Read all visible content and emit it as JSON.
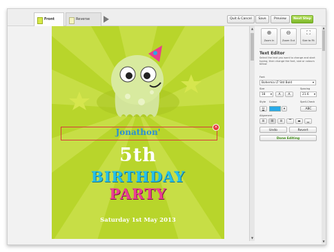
{
  "tabs": [
    {
      "label": "Front"
    },
    {
      "label": "Reverse"
    }
  ],
  "toolbar": {
    "quit_label": "Quit & Cancel",
    "save_label": "Save",
    "preview_label": "Preview",
    "next_label": "Next Step"
  },
  "card": {
    "name": "Jonathon'",
    "age": "5th",
    "line1": "BIRTHDAY",
    "line2": "PARTY",
    "date": "Saturday 1st May 2013"
  },
  "panel": {
    "zoom_in": "Zoom In",
    "zoom_out": "Zoom Out",
    "size_to_fit": "Size to Fit",
    "title": "Text Editor",
    "description": "Select the text you want to change and start typing, then change the font, size or colours below",
    "font_label": "Font",
    "font_value": "Bohemia LT Std Bold",
    "size_label": "Size",
    "size_value": "18",
    "spacing_label": "Spacing",
    "spacing_value": "21.6",
    "style_label": "Style",
    "colour_label": "Colour",
    "spellcheck_label": "Spell-Check",
    "spellcheck_btn": "ABC",
    "underline_btn": "U",
    "font_down_btn": "A",
    "font_up_btn": "A",
    "alignment_label": "Alignment",
    "undo": "Undo",
    "revert": "Revert",
    "done": "Done Editing"
  },
  "colors": {
    "accent_green": "#8cc63f",
    "card_bg": "#b8d52b",
    "text_colour": "#28aae9",
    "birthday_blue": "#26c0e8",
    "party_pink": "#ec3f93"
  }
}
